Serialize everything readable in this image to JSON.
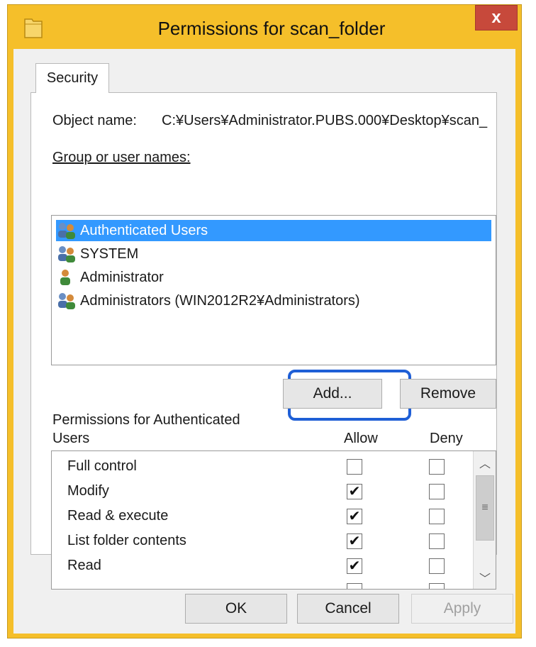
{
  "window": {
    "title": "Permissions for scan_folder",
    "close_label": "x"
  },
  "tab": {
    "label": "Security"
  },
  "object_name": {
    "label": "Object name:",
    "value": "C:¥Users¥Administrator.PUBS.000¥Desktop¥scan_"
  },
  "groups": {
    "label": "Group or user names:",
    "items": [
      {
        "label": "Authenticated Users",
        "selected": true,
        "icon": "group-users-icon"
      },
      {
        "label": "SYSTEM",
        "selected": false,
        "icon": "group-users-icon"
      },
      {
        "label": "Administrator",
        "selected": false,
        "icon": "single-user-icon"
      },
      {
        "label": "Administrators (WIN2012R2¥Administrators)",
        "selected": false,
        "icon": "group-users-icon"
      }
    ]
  },
  "buttons": {
    "add": "Add...",
    "remove": "Remove",
    "ok": "OK",
    "cancel": "Cancel",
    "apply": "Apply"
  },
  "permissions": {
    "label_line1": "Permissions for Authenticated",
    "label_line2": "Users",
    "allow_header": "Allow",
    "deny_header": "Deny",
    "rows": [
      {
        "name": "Full control",
        "allow": false,
        "deny": false
      },
      {
        "name": "Modify",
        "allow": true,
        "deny": false
      },
      {
        "name": "Read & execute",
        "allow": true,
        "deny": false
      },
      {
        "name": "List folder contents",
        "allow": true,
        "deny": false
      },
      {
        "name": "Read",
        "allow": true,
        "deny": false
      }
    ]
  },
  "colors": {
    "title_bar": "#f5bf2a",
    "close_button": "#c7493b",
    "selection": "#3399ff",
    "highlight_ring": "#1f5fd6"
  }
}
